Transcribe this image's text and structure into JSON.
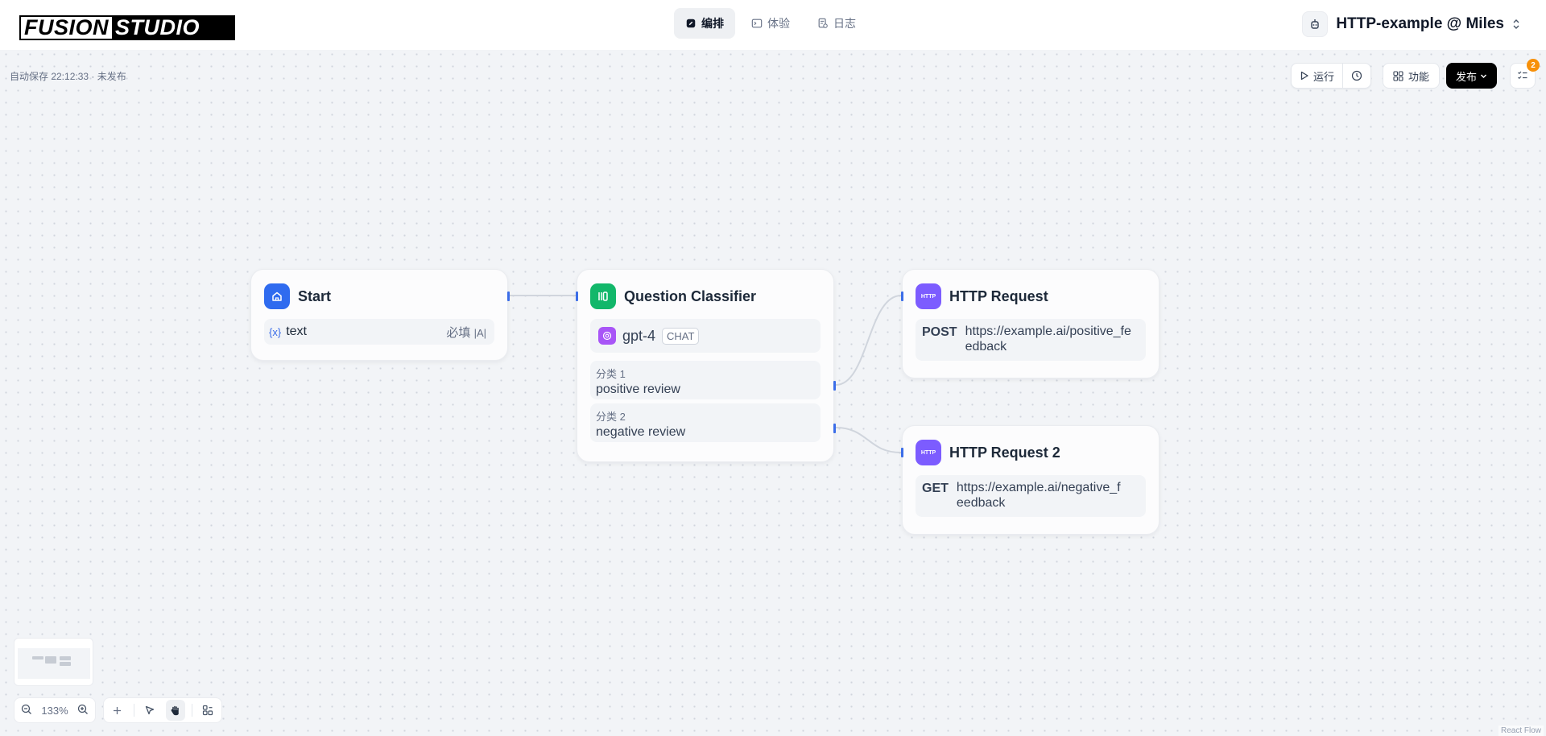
{
  "logo": {
    "word1": "FUSION",
    "word2": "STUDIO"
  },
  "tabs": [
    {
      "label": "编排",
      "active": true,
      "icon": "edit-icon"
    },
    {
      "label": "体验",
      "active": false,
      "icon": "terminal-icon"
    },
    {
      "label": "日志",
      "active": false,
      "icon": "log-icon"
    }
  ],
  "app": {
    "title": "HTTP-example @ Miles"
  },
  "autosave": {
    "text": "自动保存 22:12:33 · 未发布"
  },
  "toolbar": {
    "run_label": "运行",
    "features_label": "功能",
    "publish_label": "发布",
    "checklist_count": "2"
  },
  "nodes": {
    "start": {
      "title": "Start",
      "variable": {
        "prefix": "{x}",
        "name": "text",
        "required": "必填",
        "type_icon": "|A|"
      }
    },
    "classifier": {
      "title": "Question Classifier",
      "model": "gpt-4",
      "model_tag": "CHAT",
      "classes": [
        {
          "label": "分类 1",
          "value": "positive review"
        },
        {
          "label": "分类 2",
          "value": "negative review"
        }
      ]
    },
    "http1": {
      "title": "HTTP Request",
      "icon_text": "HTTP",
      "method": "POST",
      "url": "https://example.ai/positive_feedback"
    },
    "http2": {
      "title": "HTTP Request 2",
      "icon_text": "HTTP",
      "method": "GET",
      "url": "https://example.ai/negative_feedback"
    }
  },
  "zoom": {
    "level": "133%"
  },
  "attribution": "React Flow",
  "colors": {
    "accent": "#3b6de8",
    "start_icon": "#2f6bef",
    "classifier_icon": "#12b76a",
    "http_icon": "#7c5cff",
    "checklist_badge": "#f79009"
  }
}
